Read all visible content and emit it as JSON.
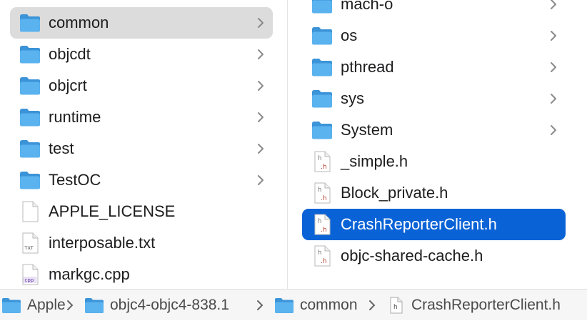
{
  "left_column": {
    "items": [
      {
        "name": "common",
        "type": "folder",
        "has_children": true,
        "selected": "inactive"
      },
      {
        "name": "objcdt",
        "type": "folder",
        "has_children": true
      },
      {
        "name": "objcrt",
        "type": "folder",
        "has_children": true
      },
      {
        "name": "runtime",
        "type": "folder",
        "has_children": true
      },
      {
        "name": "test",
        "type": "folder",
        "has_children": true
      },
      {
        "name": "TestOC",
        "type": "folder",
        "has_children": true
      },
      {
        "name": "APPLE_LICENSE",
        "type": "generic-file",
        "has_children": false
      },
      {
        "name": "interposable.txt",
        "type": "text-file",
        "icon_text": "TXT",
        "has_children": false
      },
      {
        "name": "markgc.cpp",
        "type": "cpp-file",
        "icon_text": "cpp",
        "has_children": false
      }
    ]
  },
  "right_column": {
    "items": [
      {
        "name": "mach-o",
        "type": "folder",
        "has_children": true
      },
      {
        "name": "os",
        "type": "folder",
        "has_children": true
      },
      {
        "name": "pthread",
        "type": "folder",
        "has_children": true
      },
      {
        "name": "sys",
        "type": "folder",
        "has_children": true
      },
      {
        "name": "System",
        "type": "folder",
        "has_children": true
      },
      {
        "name": "_simple.h",
        "type": "header-file",
        "icon_text": "h",
        "has_children": false
      },
      {
        "name": "Block_private.h",
        "type": "header-file",
        "icon_text": "h",
        "has_children": false
      },
      {
        "name": "CrashReporterClient.h",
        "type": "header-file",
        "icon_text": "h",
        "has_children": false,
        "selected": "active"
      },
      {
        "name": "objc-shared-cache.h",
        "type": "header-file",
        "icon_text": "h",
        "has_children": false
      }
    ]
  },
  "path_bar": {
    "crumbs": [
      {
        "label": "Apple",
        "icon": "folder-icon"
      },
      {
        "label": "objc4-objc4-838.1",
        "icon": "folder-icon"
      },
      {
        "label": "common",
        "icon": "folder-icon"
      },
      {
        "label": "CrashReporterClient.h",
        "icon": "header-file-icon",
        "icon_text": "h"
      }
    ]
  },
  "colors": {
    "folder": "#49a8e6",
    "selection_active": "#0a63d6",
    "selection_inactive": "#dcdcdc",
    "header_badge": "#b23a2f"
  }
}
